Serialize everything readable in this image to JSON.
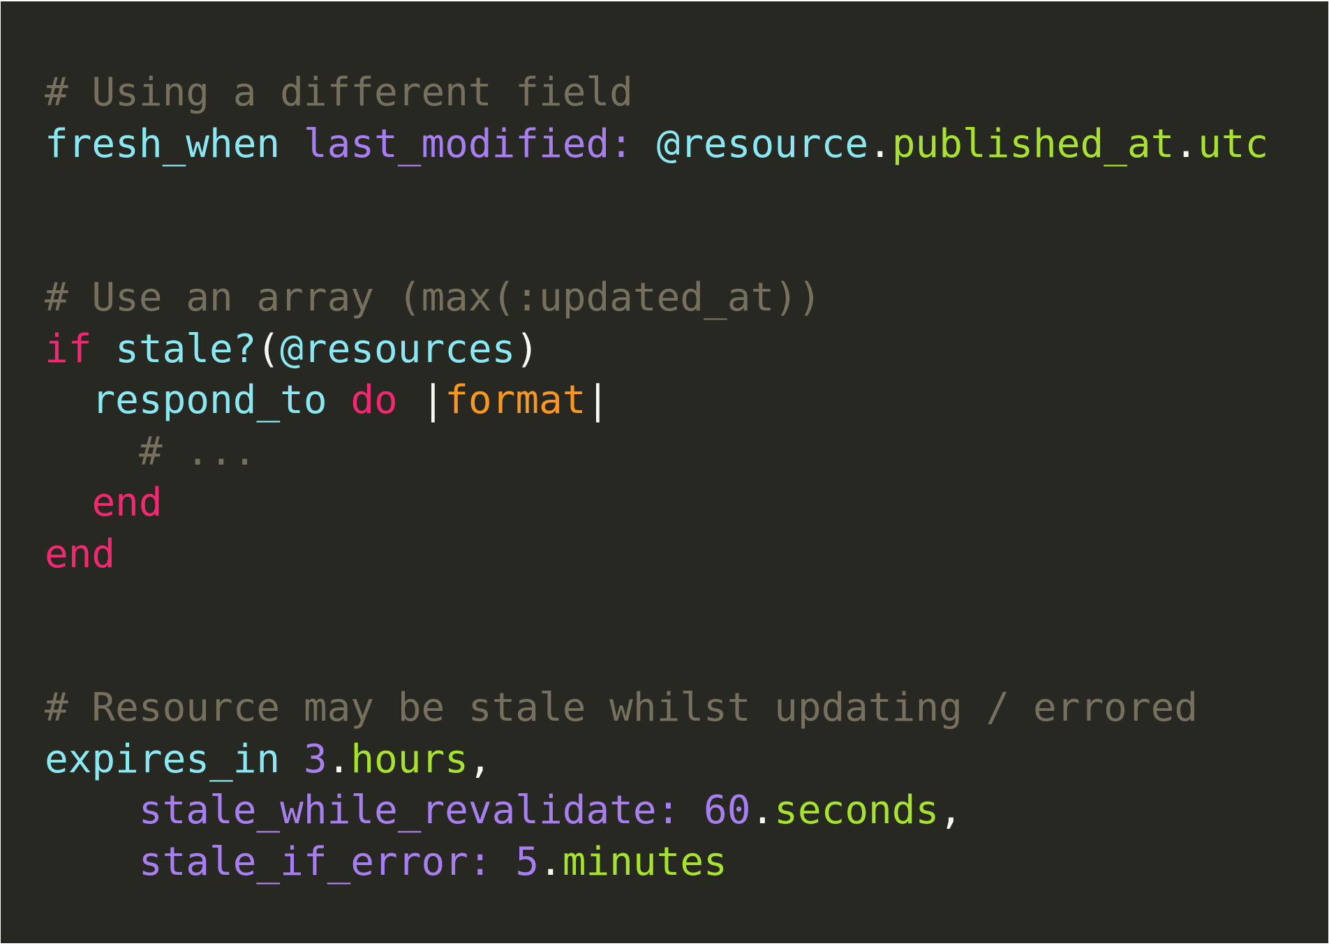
{
  "colors": {
    "background": "#272822",
    "comment": "#75715e",
    "identifier": "#8ae8f2",
    "keyword": "#f92672",
    "symbol": "#a87ff0",
    "method": "#a6e22e",
    "argument": "#fd971f",
    "plain": "#f8f8f2"
  },
  "code": {
    "lines": [
      {
        "tokens": [
          {
            "t": "c",
            "v": "# Using a different field"
          }
        ]
      },
      {
        "tokens": [
          {
            "t": "f",
            "v": "fresh_when"
          },
          {
            "t": "p",
            "v": " "
          },
          {
            "t": "s",
            "v": "last_modified:"
          },
          {
            "t": "p",
            "v": " "
          },
          {
            "t": "f",
            "v": "@resource"
          },
          {
            "t": "p",
            "v": "."
          },
          {
            "t": "m",
            "v": "published_at"
          },
          {
            "t": "p",
            "v": "."
          },
          {
            "t": "m",
            "v": "utc"
          }
        ]
      },
      {
        "tokens": []
      },
      {
        "tokens": []
      },
      {
        "tokens": [
          {
            "t": "c",
            "v": "# Use an array (max(:updated_at))"
          }
        ]
      },
      {
        "tokens": [
          {
            "t": "k",
            "v": "if"
          },
          {
            "t": "p",
            "v": " "
          },
          {
            "t": "f",
            "v": "stale?"
          },
          {
            "t": "p",
            "v": "("
          },
          {
            "t": "f",
            "v": "@resources"
          },
          {
            "t": "p",
            "v": ")"
          }
        ]
      },
      {
        "tokens": [
          {
            "t": "p",
            "v": "  "
          },
          {
            "t": "f",
            "v": "respond_to"
          },
          {
            "t": "p",
            "v": " "
          },
          {
            "t": "k",
            "v": "do"
          },
          {
            "t": "p",
            "v": " |"
          },
          {
            "t": "a",
            "v": "format"
          },
          {
            "t": "p",
            "v": "|"
          }
        ]
      },
      {
        "tokens": [
          {
            "t": "p",
            "v": "    "
          },
          {
            "t": "c",
            "v": "# ..."
          }
        ]
      },
      {
        "tokens": [
          {
            "t": "p",
            "v": "  "
          },
          {
            "t": "k",
            "v": "end"
          }
        ]
      },
      {
        "tokens": [
          {
            "t": "k",
            "v": "end"
          }
        ]
      },
      {
        "tokens": []
      },
      {
        "tokens": []
      },
      {
        "tokens": [
          {
            "t": "c",
            "v": "# Resource may be stale whilst updating / errored"
          }
        ]
      },
      {
        "tokens": [
          {
            "t": "f",
            "v": "expires_in"
          },
          {
            "t": "p",
            "v": " "
          },
          {
            "t": "s",
            "v": "3"
          },
          {
            "t": "p",
            "v": "."
          },
          {
            "t": "m",
            "v": "hours"
          },
          {
            "t": "p",
            "v": ","
          }
        ]
      },
      {
        "tokens": [
          {
            "t": "p",
            "v": "    "
          },
          {
            "t": "s",
            "v": "stale_while_revalidate:"
          },
          {
            "t": "p",
            "v": " "
          },
          {
            "t": "s",
            "v": "60"
          },
          {
            "t": "p",
            "v": "."
          },
          {
            "t": "m",
            "v": "seconds"
          },
          {
            "t": "p",
            "v": ","
          }
        ]
      },
      {
        "tokens": [
          {
            "t": "p",
            "v": "    "
          },
          {
            "t": "s",
            "v": "stale_if_error:"
          },
          {
            "t": "p",
            "v": " "
          },
          {
            "t": "s",
            "v": "5"
          },
          {
            "t": "p",
            "v": "."
          },
          {
            "t": "m",
            "v": "minutes"
          }
        ]
      }
    ]
  }
}
